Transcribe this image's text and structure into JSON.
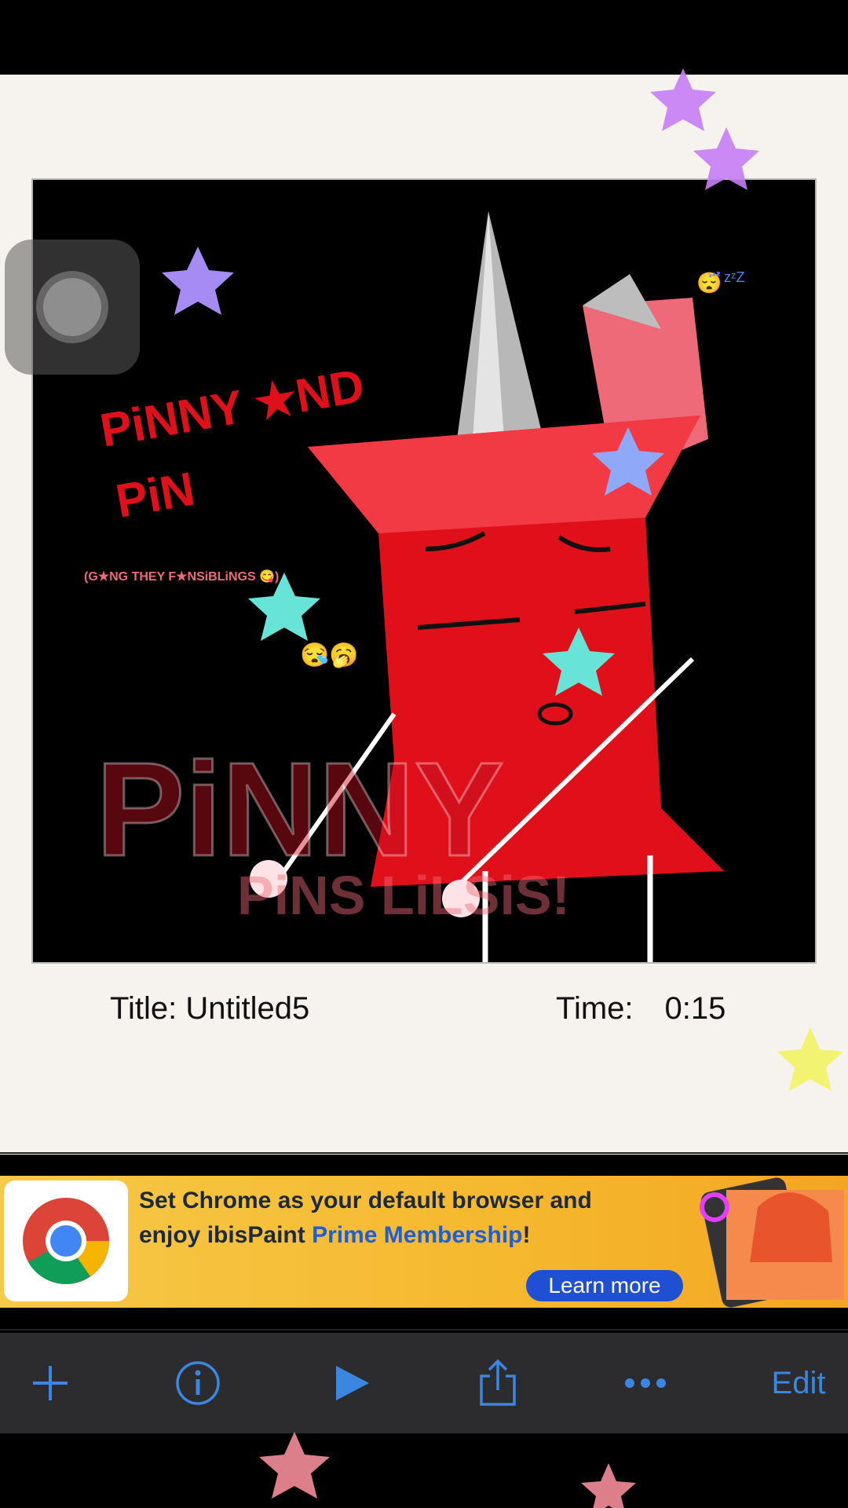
{
  "artwork": {
    "heading_line1": "PiNNY ★ND",
    "heading_line2": "PiN",
    "caption": "(G★NG THEY F★NSiBLiNGS 😋)",
    "emoji_sleep": "😴",
    "emoji_zzz": "zᶻZ",
    "emoji_faces": "😪🥱",
    "watermark_line1": "PiNNY",
    "watermark_line2": "PiNS LiLSiS!"
  },
  "info": {
    "title_label": "Title:",
    "title_value": "Untitled5",
    "time_label": "Time:",
    "time_value": "0:15"
  },
  "ad": {
    "line1": "Set Chrome as your default browser and",
    "line2_prefix": "enjoy ibisPaint ",
    "line2_highlight": "Prime Membership",
    "line2_suffix": "!",
    "cta": "Learn more"
  },
  "toolbar": {
    "add_icon": "plus-icon",
    "info_icon": "info-icon",
    "play_icon": "play-icon",
    "share_icon": "share-icon",
    "more_icon": "more-icon",
    "edit_label": "Edit"
  },
  "colors": {
    "accent": "#3a86e0",
    "pin_red": "#e0101a",
    "background": "#f6f3ee"
  }
}
